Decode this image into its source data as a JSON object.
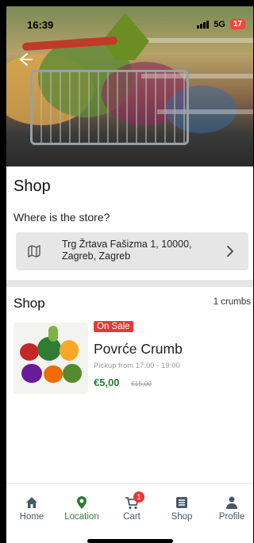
{
  "status_bar": {
    "time": "16:39",
    "network": "5G",
    "battery": "17"
  },
  "hero": {
    "image": "shopping-cart-with-vegetables"
  },
  "store": {
    "title": "Shop",
    "where_label": "Where is the store?",
    "address": "Trg Žrtava Fašizma 1, 10000, Zagreb, Zagreb"
  },
  "listing": {
    "title": "Shop",
    "count_label": "1 crumbs",
    "products": [
      {
        "badge": "On Sale",
        "name": "Povrće Crumb",
        "pickup": "Pickup from 17:00 - 19:00",
        "price": "€5,00",
        "old_price": "€15,00"
      }
    ]
  },
  "tabbar": {
    "items": [
      {
        "label": "Home",
        "icon": "home-icon",
        "active": false
      },
      {
        "label": "Location",
        "icon": "location-icon",
        "active": true
      },
      {
        "label": "Cart",
        "icon": "cart-icon",
        "active": false,
        "badge": "1"
      },
      {
        "label": "Shop",
        "icon": "list-icon",
        "active": false
      },
      {
        "label": "Profile",
        "icon": "person-icon",
        "active": false
      }
    ]
  },
  "colors": {
    "accent": "#2e7d32",
    "sale": "#e53935",
    "card_bg": "#e6e6e6",
    "tab_default": "#455a64"
  }
}
